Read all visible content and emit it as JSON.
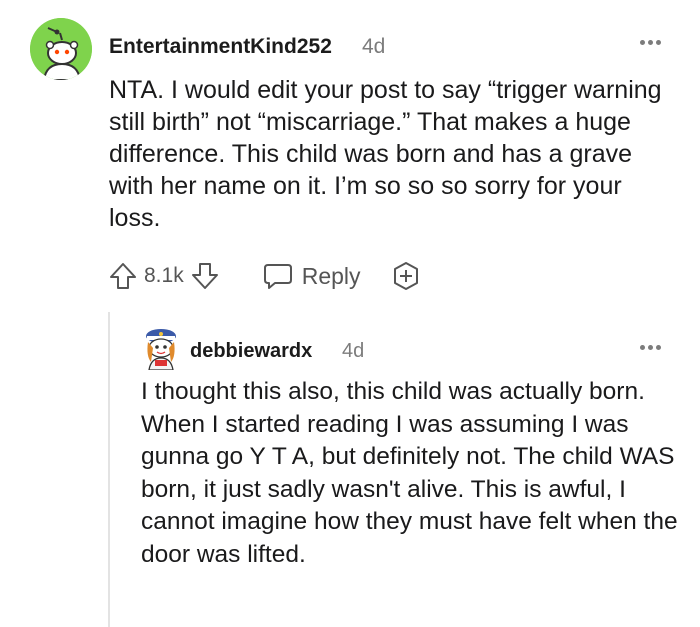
{
  "comment": {
    "username": "EntertainmentKind252",
    "age": "4d",
    "body": "NTA. I would edit your post to say “trigger warning still birth” not “miscarriage.” That makes a huge difference. This child was born and has a grave with her name on it. I’m so so so sorry for your loss.",
    "score": "8.1k",
    "reply_label": "Reply",
    "icons": {
      "upvote": "arrow-up-icon",
      "downvote": "arrow-down-icon",
      "reply": "speech-bubble-icon",
      "award": "award-plus-icon",
      "more": "ellipsis-icon"
    },
    "avatar_color": "#7fd34c"
  },
  "reply": {
    "username": "debbiewardx",
    "age": "4d",
    "body": "I thought this also, this child was actually born. When I started reading I was assuming I was gunna go Y T A, but definitely not. The child WAS born, it just sadly wasn't alive. This is awful, I cannot imagine how they must have felt when the door was lifted.",
    "icons": {
      "more": "ellipsis-icon"
    }
  }
}
